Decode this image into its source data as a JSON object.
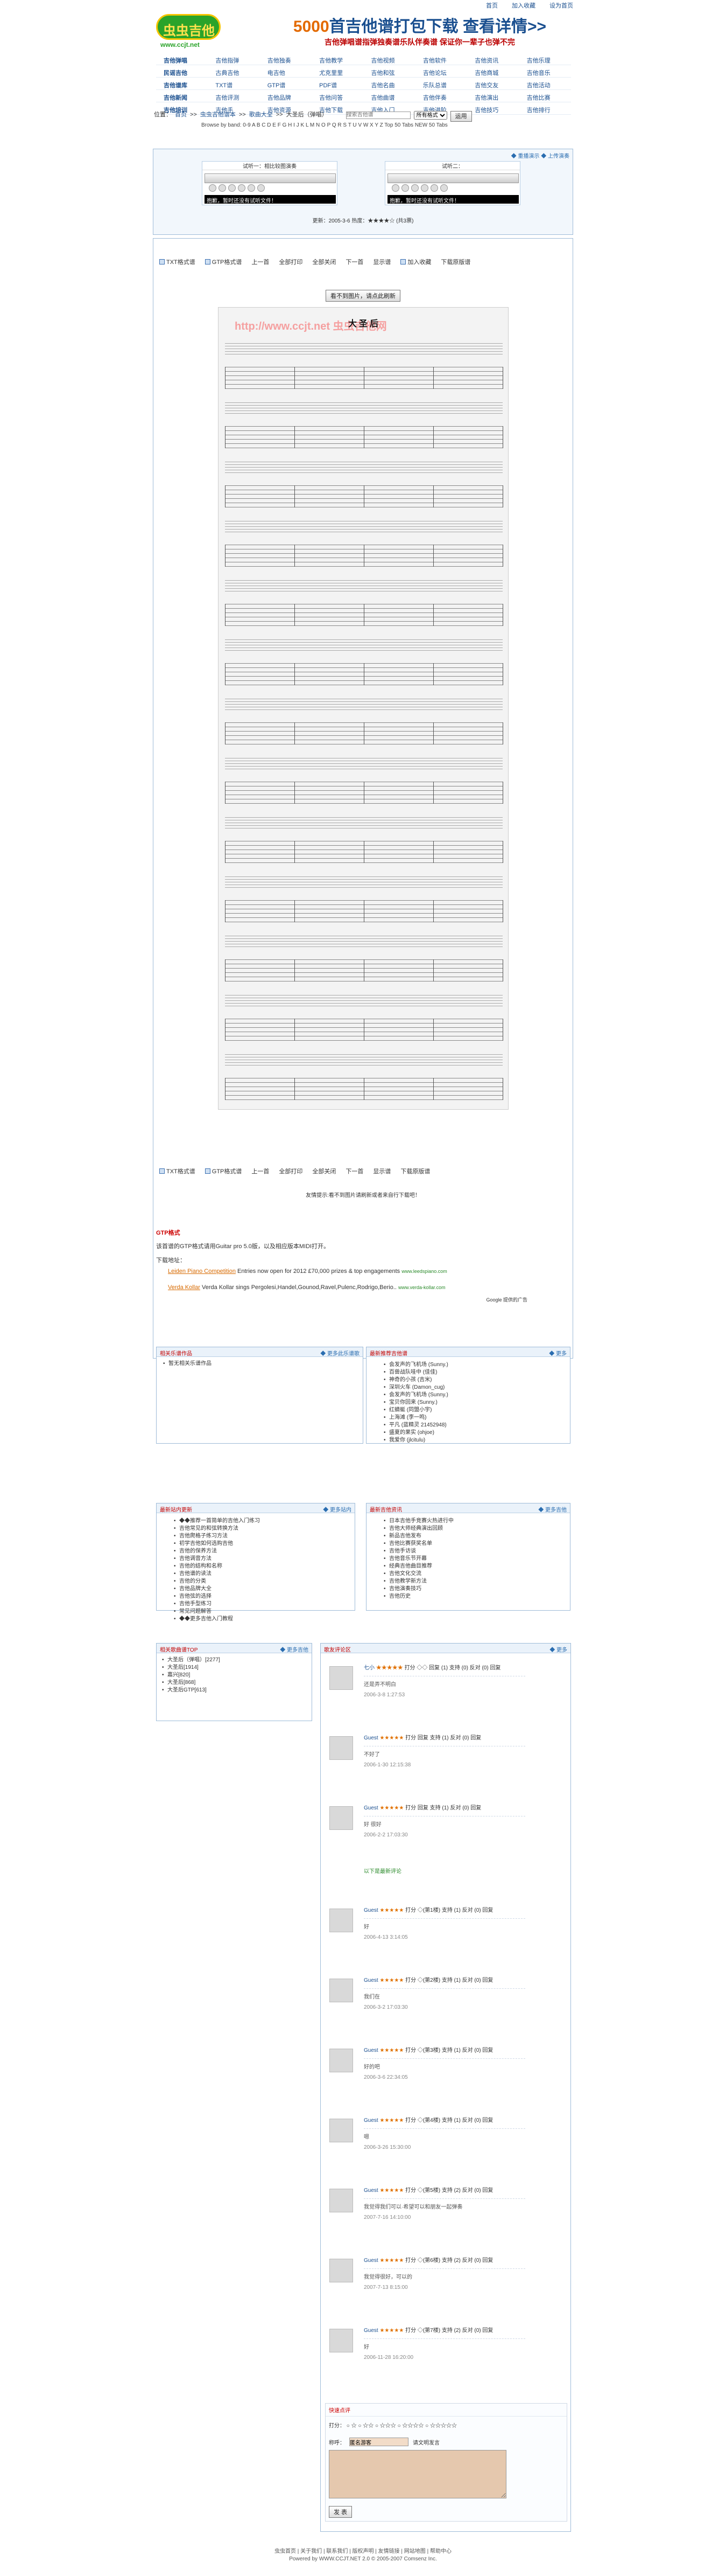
{
  "top_links": [
    "首页",
    "加入收藏",
    "设为首页"
  ],
  "logo": {
    "text": "虫虫吉他",
    "url": "www.ccjt.net"
  },
  "banner": {
    "line1_num": "5000",
    "line1": "首吉他谱打包下载",
    "line1_more": "查看详情>>",
    "line2": "吉他弹唱谱指弹独奏谱乐队伴奏谱 保证你一辈子也弹不完"
  },
  "nav": [
    "吉他弹唱",
    "吉他指弹",
    "吉他独奏",
    "吉他教学",
    "吉他视频",
    "吉他软件",
    "吉他资讯",
    "吉他乐理",
    "民谣吉他",
    "古典吉他",
    "电吉他",
    "尤克里里",
    "吉他和弦",
    "吉他论坛",
    "吉他商城",
    "吉他音乐",
    "吉他谱库",
    "TXT谱",
    "GTP谱",
    "PDF谱",
    "吉他名曲",
    "乐队总谱",
    "吉他交友",
    "吉他活动",
    "吉他新闻",
    "吉他评测",
    "吉他品牌",
    "吉他问答",
    "吉他曲谱",
    "吉他伴奏",
    "吉他演出",
    "吉他比赛",
    "吉他培训",
    "吉他手",
    "吉他资源",
    "吉他下载",
    "吉他入门",
    "吉他进阶",
    "吉他技巧",
    "吉他排行"
  ],
  "breadcrumb": {
    "prefix": "位置：",
    "items": [
      "首页",
      "虫虫吉他谱本",
      "歌曲大全",
      "大圣后（弹唱）"
    ],
    "search_placeholder": "搜索吉他谱",
    "select": "所有格式",
    "search_btn": "运用",
    "browse": "Browse by band: 0-9 A B C D E F G H I J K L M N O P Q R S T U V W X Y Z  Top 50 Tabs  NEW 50 Tabs"
  },
  "players": {
    "links": "◆ 重播演示  ◆ 上传演奏",
    "p1_cap": "试听一：相比较图演奏",
    "p2_cap": "试听二：",
    "msg": "抱歉，暂时还没有试听文件！",
    "info": "更新：2005-3-6   热度：★★★★☆  (共3票)"
  },
  "tools": {
    "items": [
      "TXT格式谱",
      "GTP格式谱",
      "上一首",
      "全部打印",
      "全部关闭",
      "下一首",
      "显示谱",
      "加入收藏",
      "下载原版谱"
    ],
    "view_btn": "看不到图片，请点此刷新"
  },
  "sheet": {
    "watermark": "http://www.ccjt.net 虫虫吉他网",
    "title": "大 圣 后"
  },
  "tip": "友情提示:看不到图片请刷新或者来自行下载吧！",
  "gtp": {
    "title": "GTP格式",
    "desc": "该首谱的GTP格式请用Guitar pro 5.0版，以及相应版本MIDI打开。",
    "download": "下载地址：",
    "ad1_t": "Leiden Piano Competition",
    "ad1": " Entries now open for 2012 £70,000 prizes & top engagements ",
    "ad1_u": "www.leedspiano.com",
    "ad2_t": "Verda Kollar",
    "ad2": " Verda Kollar sings Pergolesi,Handel,Gounod,Ravel,Pulenc,Rodrigo,Berio.. ",
    "ad2_u": "www.verda-kollar.com",
    "ad_google": "Google 提供的广告"
  },
  "box_related": {
    "title": "相关乐谱作品",
    "more": "◆ 更多此乐谱歌",
    "items": [
      "暂无相关乐谱作品"
    ]
  },
  "box_new": {
    "title": "最新推荐吉他谱",
    "more": "◆ 更多",
    "items": [
      "会发声的飞机场 (Sunny.)",
      "百兽战队哇中 (佳佳)",
      "神奇的小孩 (吉米)",
      "深圳火车 (Damon_cug)",
      "会发声的飞机场 (Sunny.)",
      "宝贝你回来 (Sunny.)",
      "红蜻蜓 (同盟小宇)",
      "上海滩 (李一鸣)",
      "平凡 (蓝精灵 21452948)",
      "盛夏的果实 (ohjoe)",
      "我爱你 (jlcitulu)"
    ]
  },
  "box_article": {
    "title": "最新站内更新",
    "more": "◆ 更多站内",
    "items": [
      "◆◆推荐一首简单的吉他入门练习",
      "吉他常见的和弦转换方法",
      "吉他爬格子练习方法",
      "初学吉他如何选购吉他",
      "吉他的保养方法",
      "吉他调音方法",
      "吉他的结构和名称",
      "吉他谱的读法",
      "吉他的分类",
      "吉他品牌大全",
      "吉他弦的选择",
      "吉他手型练习",
      "常见问题解答",
      "◆◆更多吉他入门教程"
    ]
  },
  "box_music": {
    "title": "最新吉他资讯",
    "more": "◆ 更多吉他",
    "items": [
      "日本吉他手竞赛火热进行中",
      "吉他大师经典演出回顾",
      "新品吉他发布",
      "吉他比赛获奖名单",
      "吉他手访谈",
      "吉他音乐节开幕",
      "经典吉他曲目推荐",
      "吉他文化交流",
      "吉他教学新方法",
      "吉他演奏技巧",
      "吉他历史"
    ]
  },
  "box_top": {
    "title": "相关歌曲谱TOP",
    "more": "◆ 更多吉他",
    "items": [
      "大圣后（弹唱）[2277]",
      "大圣后[1914]",
      "嘉兴[820]",
      "大圣后[868]",
      "大圣后GTP[613]"
    ]
  },
  "comments": {
    "title": "歌友评论区",
    "more": "◆ 更多",
    "list": [
      {
        "user": "七小",
        "stars": "★★★★★",
        "meta": "打分 ◇◇ 回复 (1) 支持 (0) 反对 (0) 回复",
        "body": "还是弄不明白",
        "date": "2006-3-8 1:27:53"
      },
      {
        "user": "Guest",
        "stars": "★★★★★",
        "meta": "打分 回复 支持 (1) 反对 (0) 回复",
        "body": "不好了",
        "date": "2006-1-30 12:15:38"
      },
      {
        "user": "Guest",
        "stars": "★★★★★",
        "meta": "打分 回复 支持 (1) 反对 (0) 回复",
        "body": "好 很好",
        "date": "2006-2-2 17:03:30"
      },
      {
        "user": "Guest",
        "stars": "★★★★★",
        "meta": "打分 ◇(第1楼) 支持 (1) 反对 (0) 回复",
        "body": "好",
        "date": "2006-4-13 3:14:05"
      },
      {
        "user": "Guest",
        "stars": "★★★★★",
        "meta": "打分 ◇(第2楼) 支持 (1) 反对 (0) 回复",
        "body": "我们在",
        "date": "2006-3-2 17:03:30"
      },
      {
        "user": "Guest",
        "stars": "★★★★★",
        "meta": "打分 ◇(第3楼) 支持 (1) 反对 (0) 回复",
        "body": "好的吧",
        "date": "2006-3-6 22:34:05"
      },
      {
        "user": "Guest",
        "stars": "★★★★★",
        "meta": "打分 ◇(第4楼) 支持 (1) 反对 (0) 回复",
        "body": "嗯",
        "date": "2006-3-26 15:30:00"
      },
      {
        "user": "Guest",
        "stars": "★★★★★",
        "meta": "打分 ◇(第5楼) 支持 (2) 反对 (0) 回复",
        "body": "我觉得我们可以·希望可以和朋友一起弹奏",
        "date": "2007-7-16 14:10:00"
      },
      {
        "user": "Guest",
        "stars": "★★★★★",
        "meta": "打分 ◇(第6楼) 支持 (2) 反对 (0) 回复",
        "body": "我觉得很好，可以的",
        "date": "2007-7-13 8:15:00"
      },
      {
        "user": "Guest",
        "stars": "★★★★★",
        "meta": "打分 ◇(第7楼) 支持 (2) 反对 (0) 回复",
        "body": "好",
        "date": "2006-11-28 16:20:00"
      }
    ],
    "hot_label": "以下是最新评论"
  },
  "form": {
    "title": "快速点评",
    "score_label": "打分：",
    "name_label": "称呼：",
    "name_value": "匿名游客",
    "submit": "发 表",
    "hint": "请文明发言"
  },
  "footer": {
    "line1": "虫虫首页 | 关于我们 | 联系我们 | 版权声明 | 友情链接 | 网站地图 | 帮助中心",
    "line2": "Powered by WWW.CCJT.NET 2.0 © 2005-2007 Comsenz Inc."
  }
}
